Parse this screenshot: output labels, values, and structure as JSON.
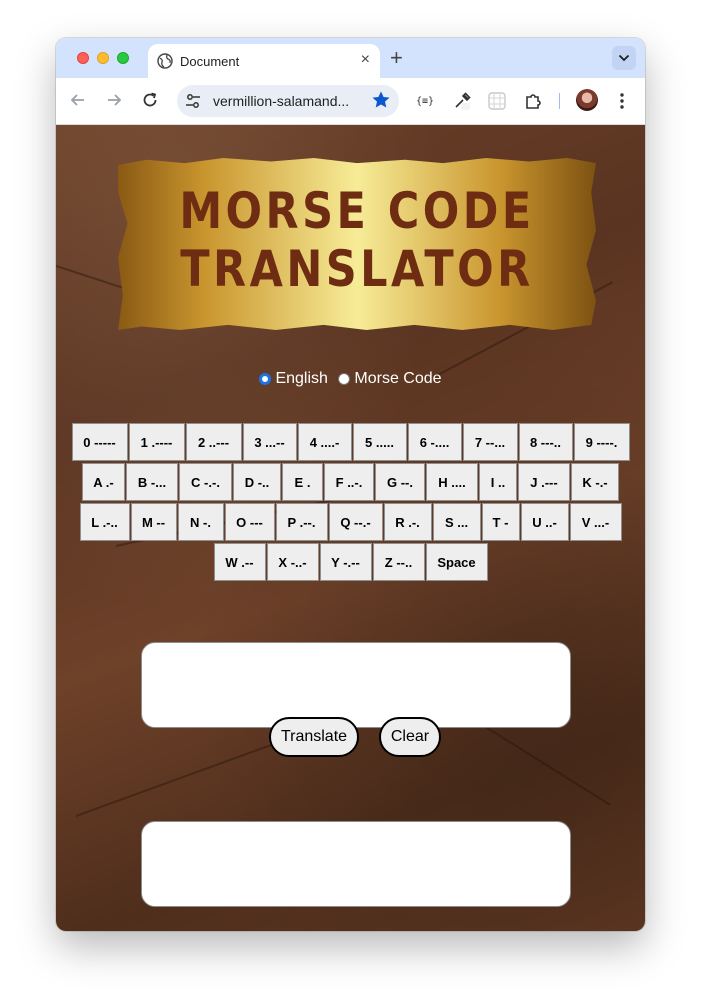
{
  "browser": {
    "tab_title": "Document",
    "tab_close": "×",
    "new_tab": "+",
    "url": "vermillion-salamand...",
    "ext_code_label": "{≡}"
  },
  "page": {
    "title_line1": "MORSE CODE",
    "title_line2": "TRANSLATOR",
    "mode_options": [
      {
        "label": "English",
        "selected": true
      },
      {
        "label": "Morse Code",
        "selected": false
      }
    ],
    "keyboard": {
      "row1": [
        "0 -----",
        "1 .----",
        "2 ..---",
        "3 ...--",
        "4 ....-",
        "5 .....",
        "6 -....",
        "7 --...",
        "8 ---..",
        "9 ----."
      ],
      "row2": [
        "A .-",
        "B -...",
        "C -.-.",
        "D -..",
        "E .",
        "F ..-.",
        "G --.",
        "H ....",
        "I ..",
        "J .---",
        "K -.-"
      ],
      "row3": [
        "L .-..",
        "M --",
        "N -.",
        "O ---",
        "P .--.",
        "Q --.-",
        "R .-.",
        "S ...",
        "T -",
        "U ..-",
        "V ...-"
      ],
      "row4": [
        "W .--",
        "X -..-",
        "Y -.--",
        "Z --..",
        "Space"
      ]
    },
    "input_value": "",
    "output_value": "",
    "translate_label": "Translate",
    "clear_label": "Clear"
  }
}
